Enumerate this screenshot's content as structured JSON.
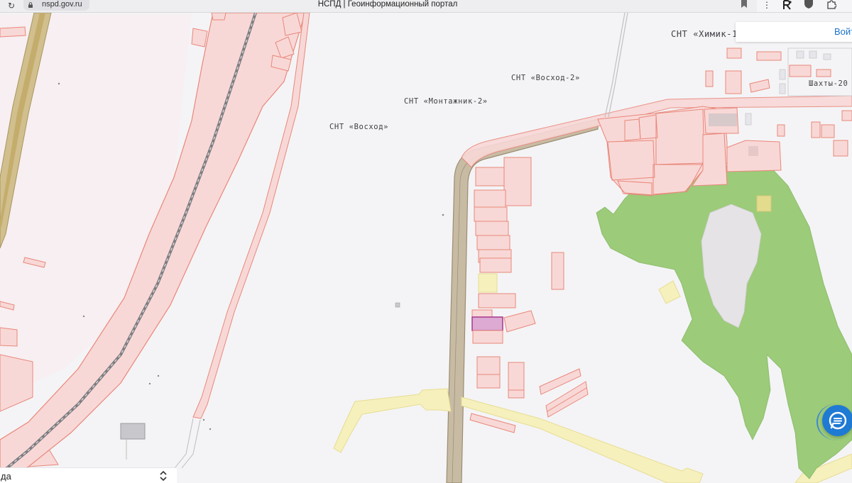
{
  "browser": {
    "url": "nspd.gov.ru",
    "page_title": "НСПД | Геоинформационный портал",
    "icons": [
      "reload-icon",
      "lock-icon",
      "bookmark-icon",
      "menu-dots-icon",
      "extension-r-icon",
      "shield-icon",
      "puzzle-icon"
    ]
  },
  "map": {
    "labels": {
      "snt_voskhod": "СНТ «Восход»",
      "snt_montazhnik_2": "СНТ «Монтажник-2»",
      "snt_voskhod_2": "СНТ «Восход-2»",
      "snt_khimik_1": "СНТ «Химик-1",
      "shakhty_20": "Шахты-20"
    },
    "colors": {
      "background": "#f4f4f6",
      "parcel_fill": "#f8d8d6",
      "parcel_stroke": "#e9877b",
      "road_fill": "#c8bba4",
      "road_stroke": "#9b8d72",
      "forest_fill": "#9ccb79",
      "yellow_zone_fill": "#f6f0bd",
      "selected_parcel_fill": "#dcaad2",
      "selected_parcel_stroke": "#a42d86"
    }
  },
  "login": {
    "label": "Войт"
  },
  "chat": {
    "icon": "chat-icon"
  },
  "layer_select": {
    "value": "да",
    "icon": "up-down-arrows-icon"
  }
}
